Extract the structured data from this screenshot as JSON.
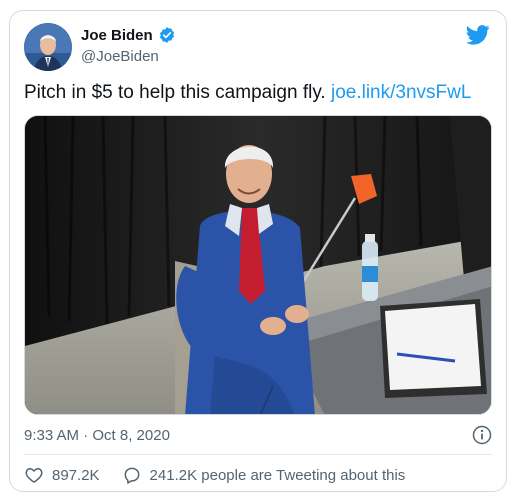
{
  "author": {
    "name": "Joe Biden",
    "handle": "@JoeBiden",
    "avatar_icon": "profile-photo",
    "verified_icon": "verified-badge-icon"
  },
  "tweet": {
    "text": "Pitch in $5 to help this campaign fly.",
    "link": "joe.link/3nvsFwL"
  },
  "meta": {
    "timestamp": "9:33 AM · Oct 8, 2020"
  },
  "actions": {
    "likes": "897.2K",
    "replies": "241.2K people are Tweeting about this"
  },
  "colors": {
    "brand": "#1d9bf0",
    "text": "#0f1419",
    "muted": "#536471"
  }
}
